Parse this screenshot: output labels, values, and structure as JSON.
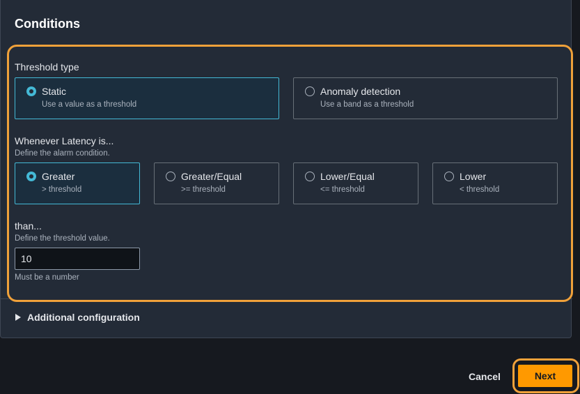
{
  "panel": {
    "title": "Conditions"
  },
  "threshold_type": {
    "label": "Threshold type",
    "options": [
      {
        "title": "Static",
        "subtitle": "Use a value as a threshold",
        "selected": true
      },
      {
        "title": "Anomaly detection",
        "subtitle": "Use a band as a threshold",
        "selected": false
      }
    ]
  },
  "condition": {
    "label": "Whenever Latency is...",
    "description": "Define the alarm condition.",
    "options": [
      {
        "title": "Greater",
        "subtitle": "> threshold",
        "selected": true
      },
      {
        "title": "Greater/Equal",
        "subtitle": ">= threshold",
        "selected": false
      },
      {
        "title": "Lower/Equal",
        "subtitle": "<= threshold",
        "selected": false
      },
      {
        "title": "Lower",
        "subtitle": "< threshold",
        "selected": false
      }
    ]
  },
  "threshold_value": {
    "label": "than...",
    "description": "Define the threshold value.",
    "value": "10",
    "constraint": "Must be a number"
  },
  "additional": {
    "label": "Additional configuration"
  },
  "footer": {
    "cancel_label": "Cancel",
    "next_label": "Next"
  },
  "colors": {
    "accent": "#44b9d6",
    "highlight": "#f0a13a",
    "primary_button": "#ff9900"
  }
}
